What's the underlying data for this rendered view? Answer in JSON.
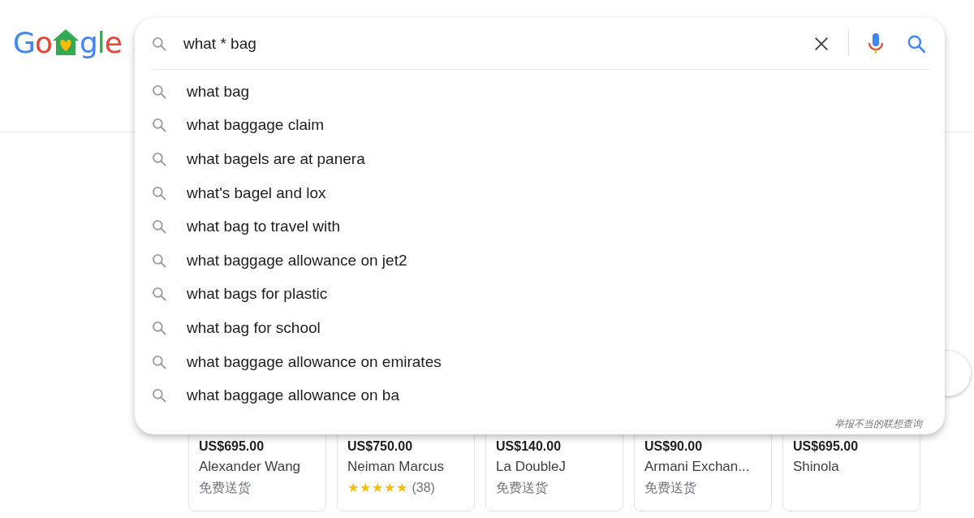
{
  "logo": {
    "letters": [
      {
        "text": "G",
        "color": "#4285f4"
      },
      {
        "text": "o",
        "color": "#ea4335"
      },
      {
        "text": "g",
        "color": "#4285f4"
      },
      {
        "text": "l",
        "color": "#34a853"
      },
      {
        "text": "e",
        "color": "#ea4335"
      }
    ]
  },
  "search": {
    "value": "what * bag",
    "suggestions": [
      "what bag",
      "what baggage claim",
      "what bagels are at panera",
      "what's bagel and lox",
      "what bag to travel with",
      "what baggage allowance on jet2",
      "what bags for plastic",
      "what bag for school",
      "what baggage allowance on emirates",
      "what baggage allowance on ba"
    ],
    "report_link": "举报不当的联想查询"
  },
  "products": [
    {
      "price": "US$695.00",
      "seller": "Alexander Wang",
      "kind": "shipping",
      "note": "免费送货"
    },
    {
      "price": "US$750.00",
      "seller": "Neiman Marcus",
      "kind": "rating",
      "stars": 5,
      "note": "(38)"
    },
    {
      "price": "US$140.00",
      "seller": "La DoubleJ",
      "kind": "shipping",
      "note": "免费送货"
    },
    {
      "price": "US$90.00",
      "seller": "Armani Exchan...",
      "kind": "shipping",
      "note": "免费送货"
    },
    {
      "price": "US$695.00",
      "seller": "Shinola",
      "kind": "none"
    }
  ]
}
